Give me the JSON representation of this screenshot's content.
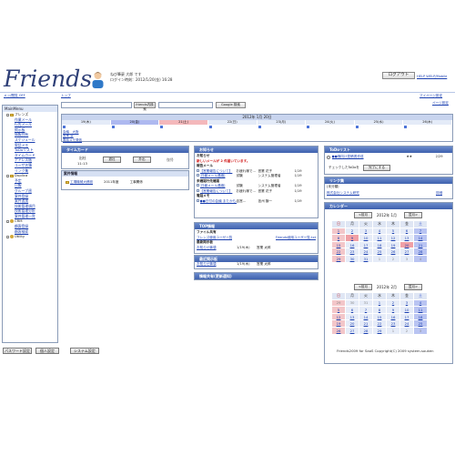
{
  "header": {
    "logo": "Friends",
    "user_line1": "ねび筆豪 大郎 です",
    "user_line2": "ログイン時刻：2012/1/20(金) 16:28",
    "logout": "ログアウト",
    "help_links": "HELP WELP/Mobile",
    "sidebar_toggle": "メッ/閲覧 OFF",
    "top_link": "トップ",
    "mypage_settings": "マイページ設定",
    "page_settings": "ページ設定"
  },
  "search": {
    "value1": "",
    "button1": "friends内検索",
    "value2": "",
    "button2": "Google 検索"
  },
  "menu": {
    "title": "MainMenu",
    "items": [
      {
        "label": "フレンズ",
        "level": "group"
      },
      {
        "label": "作業メール",
        "level": "sub"
      },
      {
        "label": "行先メール",
        "level": "sub"
      },
      {
        "label": "掲示板",
        "level": "sub"
      },
      {
        "label": "情報共有",
        "level": "sub"
      },
      {
        "label": "スケジュール",
        "level": "sub"
      },
      {
        "label": "電話メモ",
        "level": "sub"
      },
      {
        "label": "ToDoリスト",
        "level": "sub"
      },
      {
        "label": "タイムカード",
        "level": "sub"
      },
      {
        "label": "アドレス帳",
        "level": "sub"
      },
      {
        "label": "ユーザ名簿",
        "level": "sub"
      },
      {
        "label": "リンク集",
        "level": "sub"
      },
      {
        "label": "Duplica",
        "level": "group"
      },
      {
        "label": "予定",
        "level": "sub"
      },
      {
        "label": "日報",
        "level": "sub"
      },
      {
        "label": "グループ週",
        "level": "sub"
      },
      {
        "label": "案件登録",
        "level": "sub"
      },
      {
        "label": "案件追加",
        "level": "sub"
      },
      {
        "label": "技術管理項目",
        "level": "sub"
      },
      {
        "label": "技術管理分析",
        "level": "sub"
      },
      {
        "label": "案件管理一覧",
        "level": "sub"
      },
      {
        "label": "CRM",
        "level": "group"
      },
      {
        "label": "顧客登録",
        "level": "sub"
      },
      {
        "label": "顧客検索",
        "level": "sub"
      },
      {
        "label": "Utility",
        "level": "group"
      }
    ]
  },
  "calendar_strip": {
    "title": "2012年 1月 20日",
    "days": [
      {
        "label": "19(木)",
        "state": "normal"
      },
      {
        "label": "20(金)",
        "state": "today"
      },
      {
        "label": "21(土)",
        "state": "holiday"
      },
      {
        "label": "22(日)",
        "state": "normal"
      },
      {
        "label": "23(月)",
        "state": "normal"
      },
      {
        "label": "24(火)",
        "state": "normal"
      },
      {
        "label": "25(水)",
        "state": "normal"
      },
      {
        "label": "26(木)",
        "state": "normal"
      }
    ],
    "events_col1": [
      "会議　大阪",
      "営業 会",
      "電話メモ発信"
    ]
  },
  "timecard": {
    "title": "タイムカード",
    "col_in": "出社",
    "time": "11:13",
    "btn_out": "退社",
    "btn_go": "外出",
    "btn_back": "復帰"
  },
  "anken": {
    "title": "案件情報",
    "item": "工場機械大移設",
    "date": "2011年度",
    "person": "工事関係"
  },
  "oshirase": {
    "title": "お知らせ",
    "sub": "お知らせ",
    "alert": "新しいメールが 2 件届いています。",
    "work_mail_title": "報告メール",
    "work_mail": [
      {
        "subj": "【営業報告について】",
        "from": "お疲れ様で…",
        "who": "営業 花子",
        "date": "1/19"
      },
      {
        "subj": "[日報メール連絡]",
        "from": "試験",
        "who": "システム管理者",
        "date": "1/19"
      }
    ],
    "unread_title": "未確認行先確認",
    "unread": [
      {
        "subj": "[日報メール連絡]",
        "from": "試験",
        "who": "システム管理者",
        "date": "1/19"
      },
      {
        "subj": "【営業報告について】",
        "from": "お疲れ様で…",
        "who": "営業 花子",
        "date": "1/19"
      }
    ],
    "phone_title": "電話メモ",
    "phone": [
      {
        "subj": "●●日付の会議 またかも…",
        "from": "自営…",
        "who": "信州 籐一",
        "date": "1/19"
      }
    ]
  },
  "top_info": {
    "title": "TOP情報",
    "file_title": "ファイル共有",
    "file_link": "フレンズ使用ユーザー覧",
    "file_link2": "Friends使用ユーザー覧.txt",
    "bbs_title": "最新掲示板",
    "bbs_row": {
      "subj": "お知らせ事項",
      "date": "1/19(木)",
      "who": "営業 太郎",
      "num": "1/19"
    }
  },
  "recent_bbs": {
    "title": "最近掲示板",
    "row": {
      "subj": "お知らせ事項",
      "date": "1/19(木)",
      "who": "営業 太郎",
      "num": "1/19"
    }
  },
  "shared_info": {
    "title": "情報共有(更新通知)"
  },
  "todo": {
    "title": "ToDoリスト",
    "item": "●●様向け見積書作成",
    "stars": "★★",
    "due": "2/29",
    "check_label": "チェックしたToDoを",
    "done_btn": "完了にする"
  },
  "links": {
    "title": "リンク集",
    "group": "(未分類)",
    "item": "株式会社システム研究",
    "edit": "詳細"
  },
  "calendar": {
    "title": "カレンダー",
    "prev": "<前月",
    "next": "翌月>",
    "month1": "2012年 1月",
    "month2": "2012年 2月",
    "weekdays": [
      "日",
      "月",
      "火",
      "水",
      "木",
      "金",
      "土"
    ],
    "weeks1": [
      [
        "1",
        "2",
        "3",
        "4",
        "5",
        "6",
        "7"
      ],
      [
        "8",
        "9",
        "10",
        "11",
        "12",
        "13",
        "14"
      ],
      [
        "15",
        "16",
        "17",
        "18",
        "19",
        "20",
        "21"
      ],
      [
        "22",
        "23",
        "24",
        "25",
        "26",
        "27",
        "28"
      ],
      [
        "29",
        "30",
        "31",
        "1",
        "2",
        "3",
        "4"
      ]
    ],
    "weeks2": [
      [
        "29",
        "30",
        "31",
        "1",
        "2",
        "3",
        "4"
      ],
      [
        "5",
        "6",
        "7",
        "8",
        "9",
        "10",
        "11"
      ],
      [
        "12",
        "13",
        "14",
        "15",
        "16",
        "17",
        "18"
      ],
      [
        "19",
        "20",
        "21",
        "22",
        "23",
        "24",
        "25"
      ],
      [
        "26",
        "27",
        "28",
        "29",
        "1",
        "2",
        "3"
      ]
    ]
  },
  "bottom": {
    "btn1": "パスワード設定",
    "btn2": "個人設定",
    "btn3": "システム設定",
    "footer": "Friends2009 for SaaS Copyright(C) 2009 system-souken"
  }
}
